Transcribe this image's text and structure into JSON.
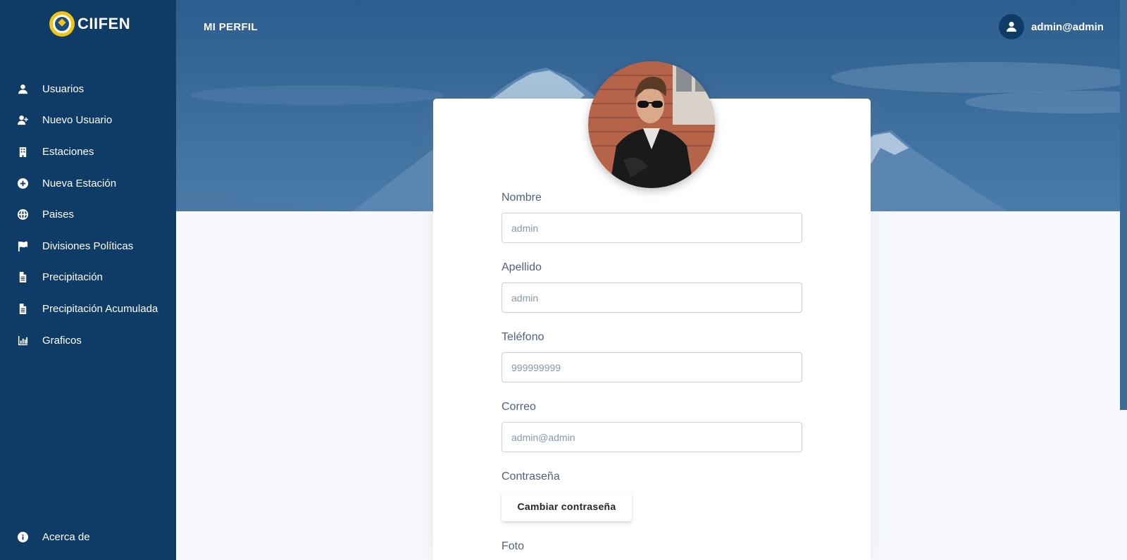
{
  "brand": {
    "name": "CIIFEN"
  },
  "sidebar": {
    "items": [
      {
        "label": "Usuarios",
        "icon": "user-icon"
      },
      {
        "label": "Nuevo Usuario",
        "icon": "user-plus-icon"
      },
      {
        "label": "Estaciones",
        "icon": "building-icon"
      },
      {
        "label": "Nueva Estación",
        "icon": "plus-circle-icon"
      },
      {
        "label": "Paises",
        "icon": "globe-icon"
      },
      {
        "label": "Divisiones Políticas",
        "icon": "flag-icon"
      },
      {
        "label": "Precipitación",
        "icon": "file-icon"
      },
      {
        "label": "Precipitación Acumulada",
        "icon": "file-icon"
      },
      {
        "label": "Graficos",
        "icon": "chart-bar-icon"
      }
    ],
    "footer": {
      "label": "Acerca de",
      "icon": "info-circle-icon"
    }
  },
  "header": {
    "title": "MI PERFIL",
    "user": "admin@admin"
  },
  "form": {
    "nombre": {
      "label": "Nombre",
      "placeholder": "admin"
    },
    "apellido": {
      "label": "Apellido",
      "placeholder": "admin"
    },
    "telefono": {
      "label": "Teléfono",
      "placeholder": "999999999"
    },
    "correo": {
      "label": "Correo",
      "placeholder": "admin@admin"
    },
    "contrasena": {
      "label": "Contraseña",
      "button": "Cambiar contraseña"
    },
    "foto": {
      "label": "Foto"
    }
  },
  "colors": {
    "sidebar": "#0f3c66",
    "hero": "#3a6c9c",
    "page_bg": "#f7f9fd",
    "label_text": "#525f7f"
  }
}
